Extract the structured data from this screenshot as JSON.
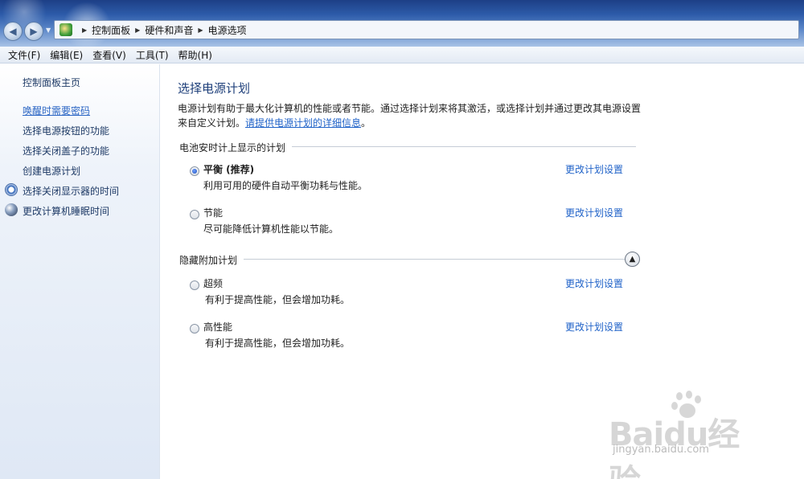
{
  "address": {
    "crumbs": [
      "控制面板",
      "硬件和声音",
      "电源选项"
    ]
  },
  "menu": [
    "文件(F)",
    "编辑(E)",
    "查看(V)",
    "工具(T)",
    "帮助(H)"
  ],
  "sidebar": {
    "home": "控制面板主页",
    "links": [
      "唤醒时需要密码",
      "选择电源按钮的功能",
      "选择关闭盖子的功能",
      "创建电源计划",
      "选择关闭显示器的时间",
      "更改计算机睡眠时间"
    ]
  },
  "main": {
    "title": "选择电源计划",
    "desc_line1": "电源计划有助于最大化计算机的性能或者节能。通过选择计划来将其激活，或选择计划并通过更改其电源设置",
    "desc_line2_prefix": "来自定义计划。",
    "desc_link": "请提供电源计划的详细信息",
    "desc_line2_suffix": "。",
    "battery_section": "电池安时计上显示的计划",
    "hidden_section": "隐藏附加计划",
    "change_link": "更改计划设置",
    "plans": [
      {
        "name": "平衡 (推荐)",
        "desc": "利用可用的硬件自动平衡功耗与性能。",
        "checked": true
      },
      {
        "name": "节能",
        "desc": "尽可能降低计算机性能以节能。",
        "checked": false
      },
      {
        "name": "超频",
        "desc": "有利于提高性能，但会增加功耗。",
        "checked": false
      },
      {
        "name": "高性能",
        "desc": "有利于提高性能，但会增加功耗。",
        "checked": false
      }
    ]
  },
  "watermark": {
    "logo": "Baidu经验",
    "url": "jingyan.baidu.com"
  }
}
